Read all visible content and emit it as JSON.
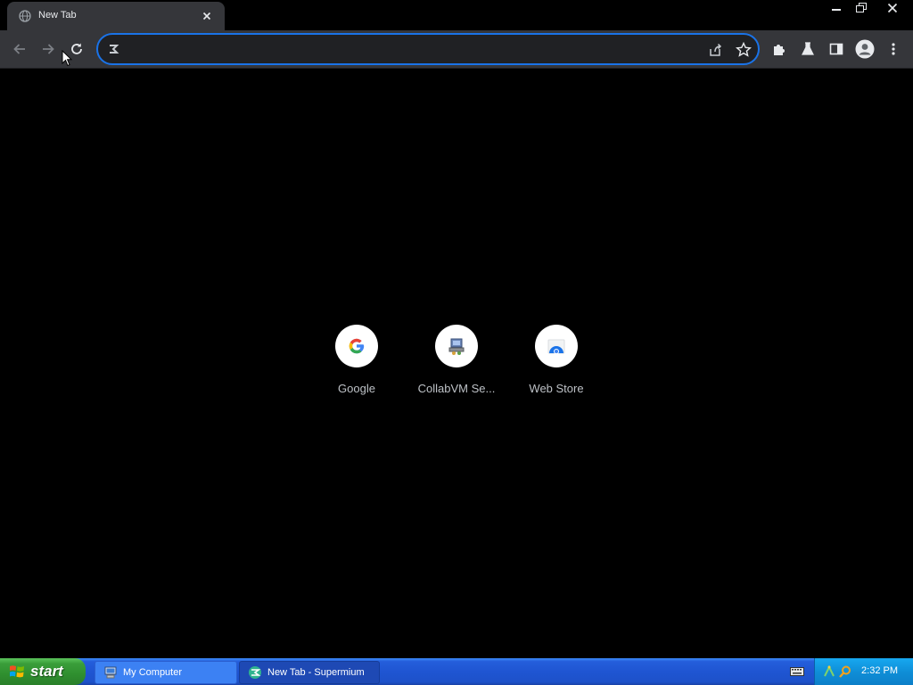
{
  "browser": {
    "tab": {
      "title": "New Tab"
    },
    "omnibox": {
      "value": "",
      "placeholder": ""
    }
  },
  "shortcuts": [
    {
      "label": "Google",
      "icon": "google-g-icon"
    },
    {
      "label": "CollabVM Se...",
      "icon": "collabvm-icon"
    },
    {
      "label": "Web Store",
      "icon": "web-store-icon"
    }
  ],
  "taskbar": {
    "start_label": "start",
    "tasks": [
      {
        "label": "My Computer",
        "icon": "my-computer-icon"
      },
      {
        "label": "New Tab - Supermium",
        "icon": "supermium-icon"
      }
    ],
    "clock": "2:32 PM"
  },
  "colors": {
    "accent": "#1a73e8",
    "toolbar": "#35363a",
    "taskbar_blue": "#245edb",
    "start_green": "#3a9e3a"
  }
}
